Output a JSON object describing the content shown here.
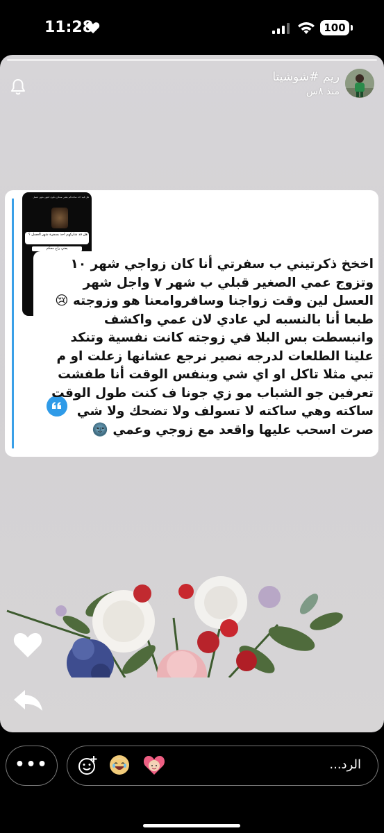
{
  "status_bar": {
    "time": "11:28",
    "battery": "100"
  },
  "story": {
    "user_name": "ريم #شوشيتا",
    "posted_ago": "منذ ٨س",
    "icons": {
      "bell": "bell-icon",
      "like": "heart-icon",
      "share": "reply-arrow-icon"
    }
  },
  "thumbnail": {
    "top_text": "هل فيه احد ساعدكم بشي ممكن يكون انتهى شهر عسل",
    "question": "هل قد شاركهم احد بسفرة شهر العسل ؟",
    "subtitle": "يعني راح معكم"
  },
  "quote": {
    "lines": [
      "اخخخ ذكرتيني ب سفرتي أنا كان زواجي شهر ١٠",
      "وتزوج عمي الصغير قبلي ب شهر ٧ واجل شهر",
      "العسل لين وقت زواجنا وسافروامعنا هو وزوجته 😢",
      "طبعا أنا بالنسبه لي عادي لان عمي واكشف",
      "وانبسطت بس البلا في زوجته كانت نفسية وتنكد",
      "علينا الطلعات لدرجه نصير نرجع عشانها زعلت او م",
      "تبي مثلا تاكل او اي شي وبنفس الوقت أنا طفشت",
      "تعرفين جو الشباب مو زي جونا ف كنت طول الوقت",
      "ساكته وهي ساكته لا تسولف ولا تضحك ولا شي",
      "صرت اسحب عليها واقعد مع زوجي وعمي 🌚"
    ]
  },
  "bottom_bar": {
    "more_label": "•••",
    "reply_placeholder": "الرد...",
    "reactions": [
      "add-emoji-icon",
      "laughing-face-emoji",
      "heart-girl-emoji"
    ]
  },
  "colors": {
    "accent_blue": "#2f9be8",
    "story_bg": "#d6d4d7"
  }
}
